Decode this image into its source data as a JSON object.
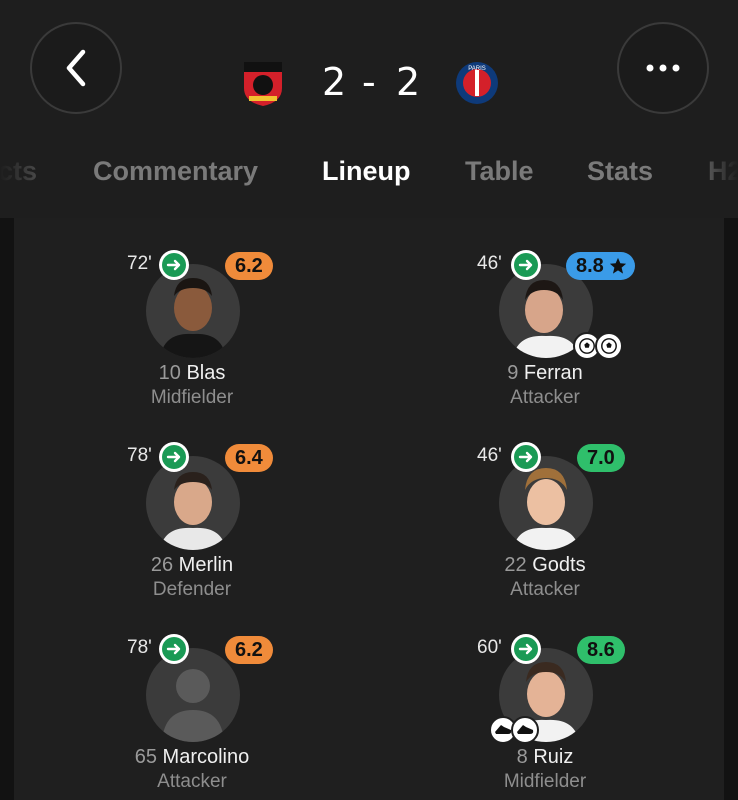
{
  "header": {
    "home_score": "2",
    "separator": "-",
    "away_score": "2",
    "home_crest": "stade-rennais-crest",
    "away_crest": "paris-saint-germain-crest",
    "away_crest_text": "PARIS",
    "back_icon": "chevron-left-icon",
    "more_icon": "more-dots-icon"
  },
  "tabs": [
    {
      "label": "cts",
      "active": false
    },
    {
      "label": "Commentary",
      "active": false
    },
    {
      "label": "Lineup",
      "active": true
    },
    {
      "label": "Table",
      "active": false
    },
    {
      "label": "Stats",
      "active": false
    },
    {
      "label": "H2",
      "active": false
    }
  ],
  "colors": {
    "rating_orange": "#f08b3a",
    "rating_green": "#2fbf6b",
    "rating_blue": "#3a9be8",
    "sub_green": "#1a9a55"
  },
  "players": {
    "left": [
      {
        "minute": "72'",
        "rating": "6.2",
        "rating_color": "orange",
        "number": "10",
        "name": "Blas",
        "position": "Midfielder"
      },
      {
        "minute": "78'",
        "rating": "6.4",
        "rating_color": "orange",
        "number": "26",
        "name": "Merlin",
        "position": "Defender"
      },
      {
        "minute": "78'",
        "rating": "6.2",
        "rating_color": "orange",
        "number": "65",
        "name": "Marcolino",
        "position": "Attacker"
      }
    ],
    "right": [
      {
        "minute": "46'",
        "rating": "8.8",
        "rating_color": "blue",
        "star": "star-icon",
        "number": "9",
        "name": "Ferran",
        "position": "Attacker",
        "badges": [
          "football-icon",
          "football-icon"
        ]
      },
      {
        "minute": "46'",
        "rating": "7.0",
        "rating_color": "green",
        "number": "22",
        "name": "Godts",
        "position": "Attacker"
      },
      {
        "minute": "60'",
        "rating": "8.6",
        "rating_color": "green",
        "number": "8",
        "name": "Ruiz",
        "position": "Midfielder",
        "badges": [
          "boot-icon",
          "boot-icon"
        ]
      }
    ]
  }
}
